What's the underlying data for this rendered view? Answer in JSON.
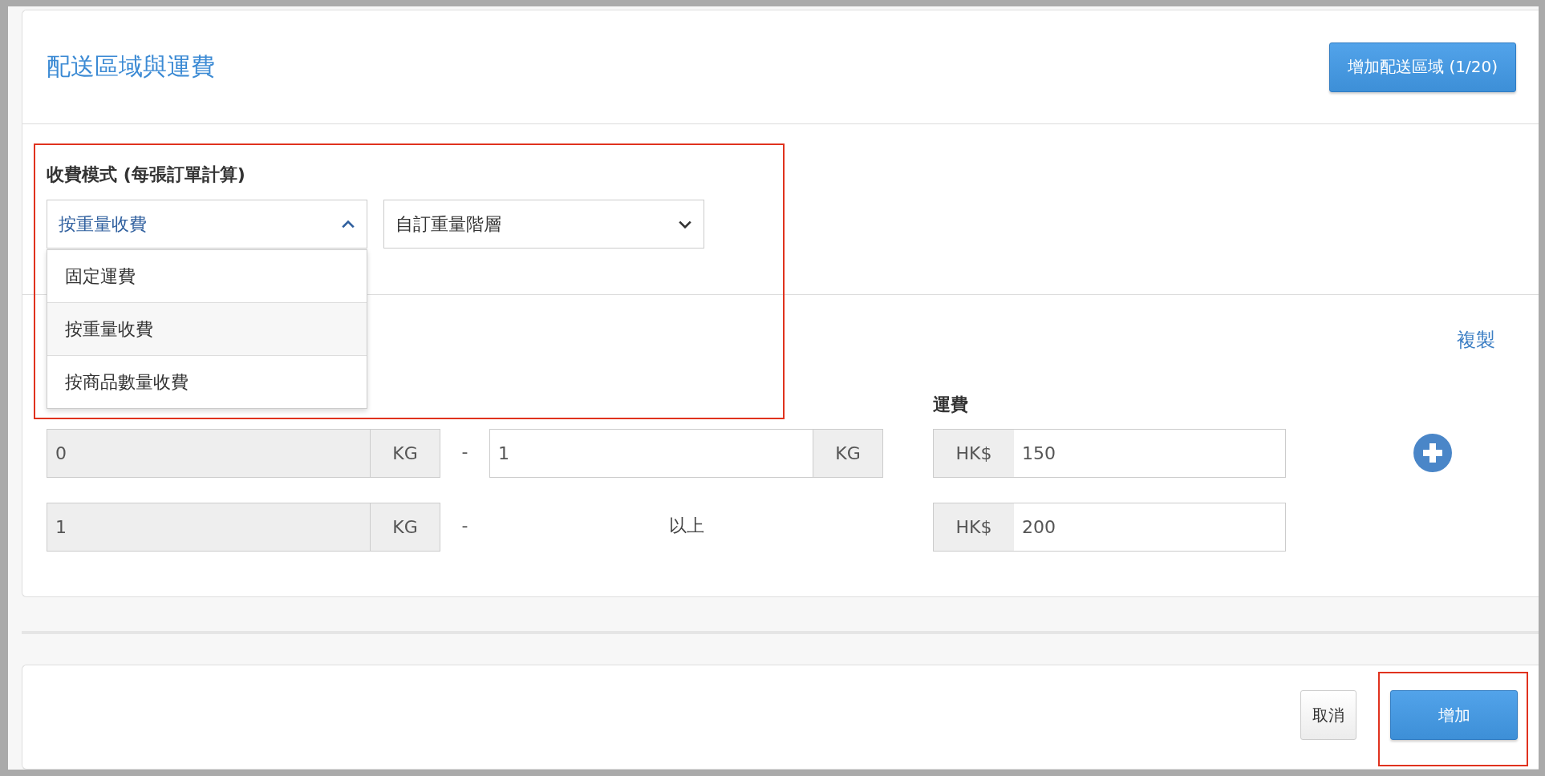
{
  "header": {
    "title": "配送區域與運費",
    "add_region_button": "增加配送區域 (1/20)"
  },
  "fee_mode": {
    "label": "收費模式 (每張訂單計算)",
    "highlighted": true,
    "mode_select": {
      "value": "按重量收費",
      "expanded": true,
      "options": [
        {
          "label": "固定運費",
          "selected": false
        },
        {
          "label": "按重量收費",
          "selected": true
        },
        {
          "label": "按商品數量收費",
          "selected": false
        }
      ]
    },
    "tier_select": {
      "value": "自訂重量階層",
      "expanded": false
    }
  },
  "rates": {
    "copy_link": "複製",
    "fee_heading": "運費",
    "rows": [
      {
        "kind": "range",
        "from": "0",
        "from_unit": "KG",
        "separator": "-",
        "to": "1",
        "to_unit": "KG",
        "currency": "HK$",
        "fee": "150",
        "add_button": true
      },
      {
        "kind": "open",
        "from": "1",
        "from_unit": "KG",
        "separator": "-",
        "to_label": "以上",
        "currency": "HK$",
        "fee": "200",
        "add_button": false
      }
    ]
  },
  "footer": {
    "cancel_button": "取消",
    "submit_button": {
      "label": "增加",
      "highlighted": true
    }
  }
}
